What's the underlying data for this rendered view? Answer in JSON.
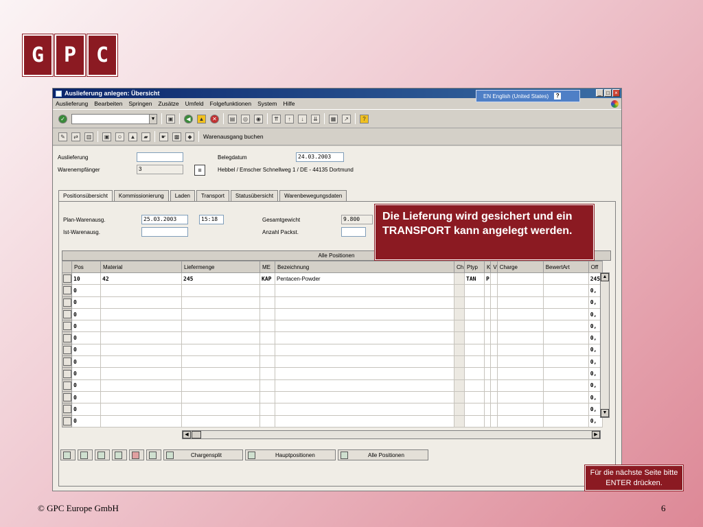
{
  "logo": {
    "letters": [
      "G",
      "P",
      "C"
    ]
  },
  "window": {
    "title": "Auslieferung anlegen: Übersicht",
    "language": "EN English (United States)",
    "help_glyph": "?",
    "min_glyph": "_",
    "max_glyph": "□",
    "close_glyph": "×"
  },
  "menu": [
    "Auslieferung",
    "Bearbeiten",
    "Springen",
    "Zusätze",
    "Umfeld",
    "Folgefunktionen",
    "System",
    "Hilfe"
  ],
  "toolbar2": {
    "goods_issue_label": "Warenausgang buchen"
  },
  "header": {
    "auslieferung_label": "Auslieferung",
    "auslieferung_value": "",
    "warenempfaenger_label": "Warenempfänger",
    "warenempfaenger_value": "3",
    "belegdatum_label": "Belegdatum",
    "belegdatum_value": "24.03.2003",
    "address": "Hebbel / Emscher Schnellweg 1 / DE - 44135 Dortmund"
  },
  "tabs": [
    "Positionsübersicht",
    "Kommissionierung",
    "Laden",
    "Transport",
    "Statusübersicht",
    "Warenbewegungsdaten"
  ],
  "panel": {
    "plan_label": "Plan-Warenausg.",
    "plan_date": "25.03.2003",
    "plan_time": "15:18",
    "ist_label": "Ist-Warenausg.",
    "ist_value": "",
    "gesamtgewicht_label": "Gesamtgewicht",
    "gesamtgewicht_value": "9.800",
    "anzahl_label": "Anzahl Packst.",
    "anzahl_value": ""
  },
  "grid": {
    "title": "Alle Positionen",
    "columns": [
      "Pos",
      "Material",
      "Liefermenge",
      "ME",
      "Bezeichnung",
      "Ch",
      "Ptyp",
      "K",
      "V",
      "Charge",
      "BewertArt",
      "Off"
    ],
    "first_row": {
      "pos": "10",
      "material": "42",
      "menge": "245",
      "me": "KAP",
      "bezeichnung": "Pentacen-Powder",
      "ptyp": "TAN",
      "k": "P",
      "off": "245"
    },
    "empty_rows": [
      {
        "pos": "0",
        "off": "0,"
      },
      {
        "pos": "0",
        "off": "0,"
      },
      {
        "pos": "0",
        "off": "0,"
      },
      {
        "pos": "0",
        "off": "0,"
      },
      {
        "pos": "0",
        "off": "0,"
      },
      {
        "pos": "0",
        "off": "0,"
      },
      {
        "pos": "0",
        "off": "0,"
      },
      {
        "pos": "0",
        "off": "0,"
      },
      {
        "pos": "0",
        "off": "0,"
      },
      {
        "pos": "0",
        "off": "0,"
      },
      {
        "pos": "0",
        "off": "0,"
      },
      {
        "pos": "0",
        "off": "0,"
      }
    ]
  },
  "bottom": {
    "chargensplit": "Chargensplit",
    "hauptpositionen": "Hauptpositionen",
    "alle_positionen": "Alle Positionen"
  },
  "callout": "Die Lieferung wird gesichert und ein TRANSPORT kann angelegt werden.",
  "enter_hint": "Für die nächste Seite bitte ENTER drücken.",
  "footer": {
    "copyright": "© GPC Europe GmbH",
    "page": "6"
  },
  "colors": {
    "accent": "#8b1a22",
    "titlebar": "#0a246a",
    "sap_bg": "#d4d0c8"
  }
}
